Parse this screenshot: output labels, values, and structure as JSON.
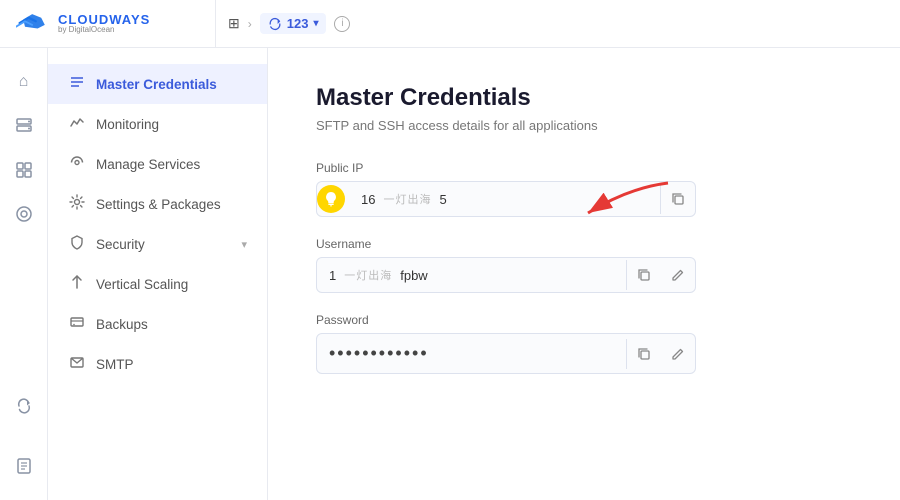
{
  "header": {
    "logo_brand": "CLOUDWAYS",
    "logo_sub": "by DigitalOcean",
    "server_id": "123",
    "info_tooltip": "Server info"
  },
  "sidebar_nav": {
    "icons": [
      {
        "name": "home-icon",
        "symbol": "⌂",
        "active": false
      },
      {
        "name": "servers-icon",
        "symbol": "⊞",
        "active": false
      },
      {
        "name": "apps-icon",
        "symbol": "▭",
        "active": false
      },
      {
        "name": "monitoring-nav-icon",
        "symbol": "◎",
        "active": false
      }
    ],
    "bottom_icons": [
      {
        "name": "sync-icon",
        "symbol": "⟳",
        "active": false
      },
      {
        "name": "file-icon",
        "symbol": "⬜",
        "active": false
      }
    ]
  },
  "sub_sidebar": {
    "items": [
      {
        "id": "master-credentials",
        "label": "Master Credentials",
        "icon": "≡",
        "active": true
      },
      {
        "id": "monitoring",
        "label": "Monitoring",
        "icon": "📈",
        "active": false
      },
      {
        "id": "manage-services",
        "label": "Manage Services",
        "icon": "🔧",
        "active": false
      },
      {
        "id": "settings-packages",
        "label": "Settings & Packages",
        "icon": "⚙",
        "active": false
      },
      {
        "id": "security",
        "label": "Security",
        "icon": "🛡",
        "active": false,
        "has_chevron": true
      },
      {
        "id": "vertical-scaling",
        "label": "Vertical Scaling",
        "icon": "↑",
        "active": false
      },
      {
        "id": "backups",
        "label": "Backups",
        "icon": "⊟",
        "active": false
      },
      {
        "id": "smtp",
        "label": "SMTP",
        "icon": "✉",
        "active": false
      }
    ]
  },
  "main_content": {
    "title": "Master Credentials",
    "subtitle": "SFTP and SSH access details for all applications",
    "fields": {
      "public_ip": {
        "label": "Public IP",
        "value_part1": "16",
        "value_part2": "5",
        "copy_tooltip": "Copy"
      },
      "username": {
        "label": "Username",
        "prefix": "1",
        "value": "fpbw",
        "copy_tooltip": "Copy",
        "edit_tooltip": "Edit"
      },
      "password": {
        "label": "Password",
        "value": "••••••••••••",
        "copy_tooltip": "Copy",
        "edit_tooltip": "Edit"
      }
    }
  }
}
